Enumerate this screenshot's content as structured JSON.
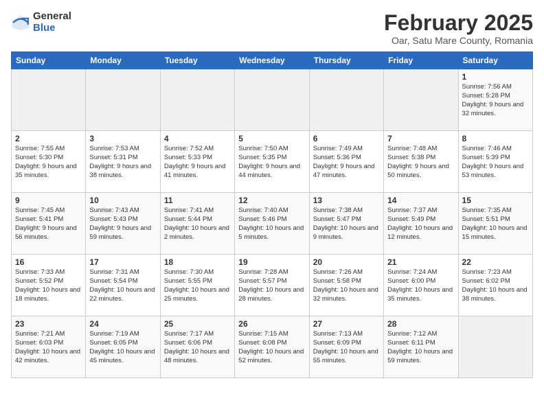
{
  "logo": {
    "general": "General",
    "blue": "Blue"
  },
  "title": "February 2025",
  "location": "Oar, Satu Mare County, Romania",
  "weekdays": [
    "Sunday",
    "Monday",
    "Tuesday",
    "Wednesday",
    "Thursday",
    "Friday",
    "Saturday"
  ],
  "weeks": [
    [
      {
        "day": "",
        "info": ""
      },
      {
        "day": "",
        "info": ""
      },
      {
        "day": "",
        "info": ""
      },
      {
        "day": "",
        "info": ""
      },
      {
        "day": "",
        "info": ""
      },
      {
        "day": "",
        "info": ""
      },
      {
        "day": "1",
        "info": "Sunrise: 7:56 AM\nSunset: 5:28 PM\nDaylight: 9 hours and 32 minutes."
      }
    ],
    [
      {
        "day": "2",
        "info": "Sunrise: 7:55 AM\nSunset: 5:30 PM\nDaylight: 9 hours and 35 minutes."
      },
      {
        "day": "3",
        "info": "Sunrise: 7:53 AM\nSunset: 5:31 PM\nDaylight: 9 hours and 38 minutes."
      },
      {
        "day": "4",
        "info": "Sunrise: 7:52 AM\nSunset: 5:33 PM\nDaylight: 9 hours and 41 minutes."
      },
      {
        "day": "5",
        "info": "Sunrise: 7:50 AM\nSunset: 5:35 PM\nDaylight: 9 hours and 44 minutes."
      },
      {
        "day": "6",
        "info": "Sunrise: 7:49 AM\nSunset: 5:36 PM\nDaylight: 9 hours and 47 minutes."
      },
      {
        "day": "7",
        "info": "Sunrise: 7:48 AM\nSunset: 5:38 PM\nDaylight: 9 hours and 50 minutes."
      },
      {
        "day": "8",
        "info": "Sunrise: 7:46 AM\nSunset: 5:39 PM\nDaylight: 9 hours and 53 minutes."
      }
    ],
    [
      {
        "day": "9",
        "info": "Sunrise: 7:45 AM\nSunset: 5:41 PM\nDaylight: 9 hours and 56 minutes."
      },
      {
        "day": "10",
        "info": "Sunrise: 7:43 AM\nSunset: 5:43 PM\nDaylight: 9 hours and 59 minutes."
      },
      {
        "day": "11",
        "info": "Sunrise: 7:41 AM\nSunset: 5:44 PM\nDaylight: 10 hours and 2 minutes."
      },
      {
        "day": "12",
        "info": "Sunrise: 7:40 AM\nSunset: 5:46 PM\nDaylight: 10 hours and 5 minutes."
      },
      {
        "day": "13",
        "info": "Sunrise: 7:38 AM\nSunset: 5:47 PM\nDaylight: 10 hours and 9 minutes."
      },
      {
        "day": "14",
        "info": "Sunrise: 7:37 AM\nSunset: 5:49 PM\nDaylight: 10 hours and 12 minutes."
      },
      {
        "day": "15",
        "info": "Sunrise: 7:35 AM\nSunset: 5:51 PM\nDaylight: 10 hours and 15 minutes."
      }
    ],
    [
      {
        "day": "16",
        "info": "Sunrise: 7:33 AM\nSunset: 5:52 PM\nDaylight: 10 hours and 18 minutes."
      },
      {
        "day": "17",
        "info": "Sunrise: 7:31 AM\nSunset: 5:54 PM\nDaylight: 10 hours and 22 minutes."
      },
      {
        "day": "18",
        "info": "Sunrise: 7:30 AM\nSunset: 5:55 PM\nDaylight: 10 hours and 25 minutes."
      },
      {
        "day": "19",
        "info": "Sunrise: 7:28 AM\nSunset: 5:57 PM\nDaylight: 10 hours and 28 minutes."
      },
      {
        "day": "20",
        "info": "Sunrise: 7:26 AM\nSunset: 5:58 PM\nDaylight: 10 hours and 32 minutes."
      },
      {
        "day": "21",
        "info": "Sunrise: 7:24 AM\nSunset: 6:00 PM\nDaylight: 10 hours and 35 minutes."
      },
      {
        "day": "22",
        "info": "Sunrise: 7:23 AM\nSunset: 6:02 PM\nDaylight: 10 hours and 38 minutes."
      }
    ],
    [
      {
        "day": "23",
        "info": "Sunrise: 7:21 AM\nSunset: 6:03 PM\nDaylight: 10 hours and 42 minutes."
      },
      {
        "day": "24",
        "info": "Sunrise: 7:19 AM\nSunset: 6:05 PM\nDaylight: 10 hours and 45 minutes."
      },
      {
        "day": "25",
        "info": "Sunrise: 7:17 AM\nSunset: 6:06 PM\nDaylight: 10 hours and 48 minutes."
      },
      {
        "day": "26",
        "info": "Sunrise: 7:15 AM\nSunset: 6:08 PM\nDaylight: 10 hours and 52 minutes."
      },
      {
        "day": "27",
        "info": "Sunrise: 7:13 AM\nSunset: 6:09 PM\nDaylight: 10 hours and 55 minutes."
      },
      {
        "day": "28",
        "info": "Sunrise: 7:12 AM\nSunset: 6:11 PM\nDaylight: 10 hours and 59 minutes."
      },
      {
        "day": "",
        "info": ""
      }
    ]
  ]
}
